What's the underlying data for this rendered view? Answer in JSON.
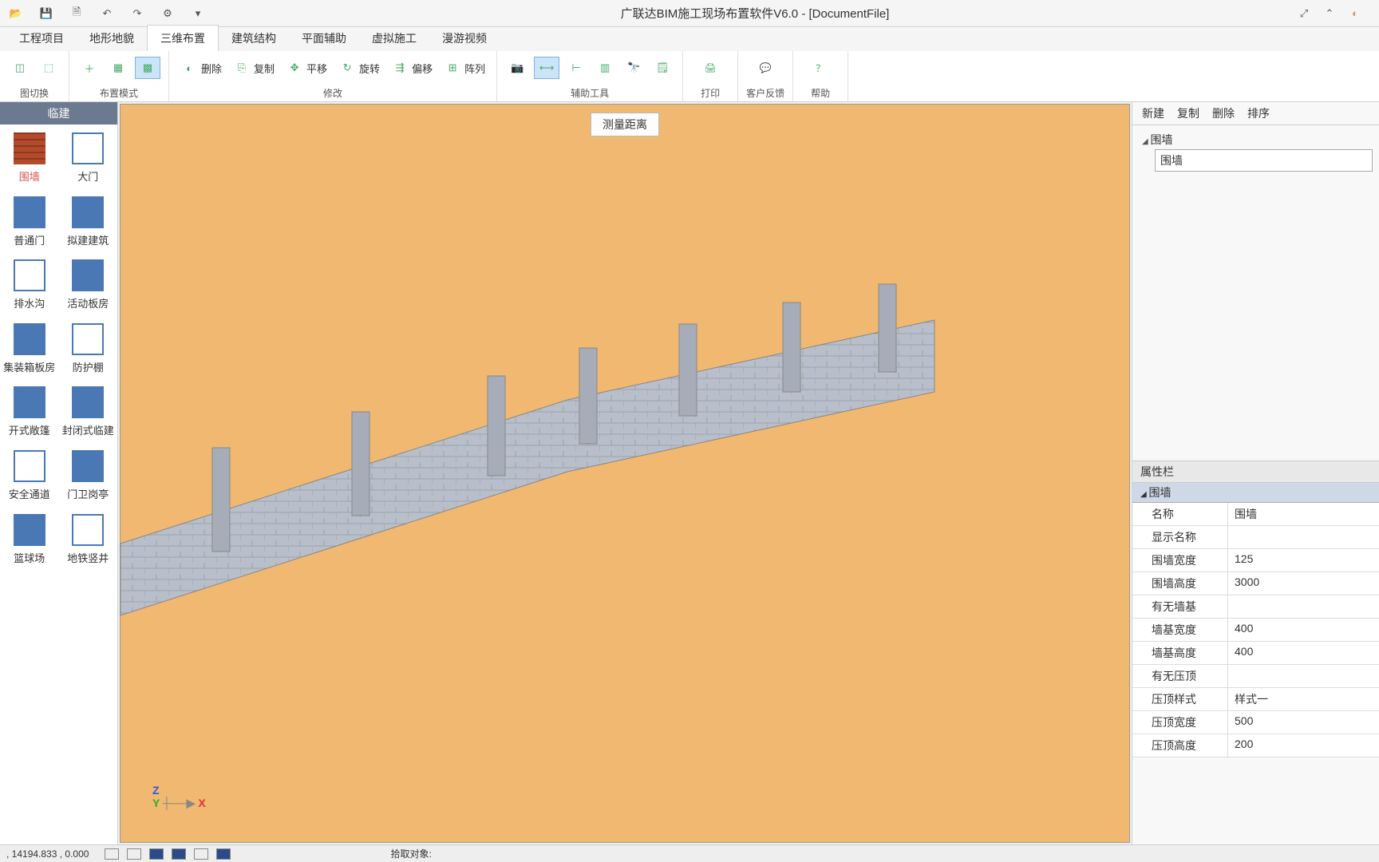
{
  "app": {
    "title": "广联达BIM施工现场布置软件V6.0 - [DocumentFile]"
  },
  "menu": {
    "tabs": [
      "工程项目",
      "地形地貌",
      "三维布置",
      "建筑结构",
      "平面辅助",
      "虚拟施工",
      "漫游视频"
    ],
    "active": 2
  },
  "ribbon": {
    "groups": [
      {
        "label": "图切换",
        "items": [
          {
            "icon": "cube",
            "big": true,
            "label": ""
          },
          {
            "icon": "cube-dash",
            "big": true,
            "label": ""
          }
        ]
      },
      {
        "label": "布置模式",
        "items": [
          {
            "icon": "plus",
            "label": ""
          },
          {
            "icon": "grid",
            "label": ""
          },
          {
            "icon": "grid-sel",
            "label": "",
            "active": true
          }
        ]
      },
      {
        "label": "修改",
        "items": [
          {
            "icon": "eraser",
            "label": "删除"
          },
          {
            "icon": "copy",
            "label": "复制"
          },
          {
            "icon": "move",
            "label": "平移"
          },
          {
            "icon": "rotate",
            "label": "旋转"
          },
          {
            "icon": "offset",
            "label": "偏移"
          },
          {
            "icon": "array",
            "label": "阵列"
          }
        ]
      },
      {
        "label": "辅助工具",
        "items": [
          {
            "icon": "camera",
            "label": ""
          },
          {
            "icon": "measure",
            "label": "",
            "active": true
          },
          {
            "icon": "ruler",
            "label": ""
          },
          {
            "icon": "chart",
            "label": ""
          },
          {
            "icon": "binoc",
            "label": ""
          },
          {
            "icon": "note",
            "label": ""
          }
        ]
      },
      {
        "label": "打印",
        "items": [
          {
            "icon": "print",
            "big": true,
            "label": ""
          }
        ]
      },
      {
        "label": "客户反馈",
        "items": [
          {
            "icon": "feedback",
            "big": true,
            "label": ""
          }
        ]
      },
      {
        "label": "帮助",
        "items": [
          {
            "icon": "help",
            "big": true,
            "label": ""
          }
        ]
      }
    ]
  },
  "palette": {
    "header": "临建",
    "items": [
      {
        "label": "围墙",
        "icon": "brick",
        "selected": true
      },
      {
        "label": "大门",
        "icon": "gate"
      },
      {
        "label": "普通门",
        "icon": "door"
      },
      {
        "label": "拟建建筑",
        "icon": "building"
      },
      {
        "label": "排水沟",
        "icon": "drain"
      },
      {
        "label": "活动板房",
        "icon": "prefab"
      },
      {
        "label": "集装箱板房",
        "icon": "container"
      },
      {
        "label": "防护棚",
        "icon": "shed"
      },
      {
        "label": "开式敞篷",
        "icon": "open"
      },
      {
        "label": "封闭式临建",
        "icon": "closed"
      },
      {
        "label": "安全通道",
        "icon": "passage"
      },
      {
        "label": "门卫岗亭",
        "icon": "guard"
      },
      {
        "label": "篮球场",
        "icon": "court"
      },
      {
        "label": "地铁竖井",
        "icon": "shaft"
      }
    ]
  },
  "viewport": {
    "float_label": "测量距离",
    "axes": {
      "x": "X",
      "y": "Y",
      "z": "Z"
    }
  },
  "rightpanel": {
    "toolbar": [
      "新建",
      "复制",
      "删除",
      "排序"
    ],
    "tree": {
      "root": "围墙",
      "selected": "围墙"
    },
    "props_header": "属性栏",
    "props_group": "围墙",
    "props": [
      {
        "k": "名称",
        "v": "围墙"
      },
      {
        "k": "显示名称",
        "v": ""
      },
      {
        "k": "围墙宽度",
        "v": "125"
      },
      {
        "k": "围墙高度",
        "v": "3000"
      },
      {
        "k": "有无墙基",
        "v": ""
      },
      {
        "k": "墙基宽度",
        "v": "400"
      },
      {
        "k": "墙基高度",
        "v": "400"
      },
      {
        "k": "有无压顶",
        "v": ""
      },
      {
        "k": "压顶样式",
        "v": "样式一"
      },
      {
        "k": "压顶宽度",
        "v": "500"
      },
      {
        "k": "压顶高度",
        "v": "200"
      }
    ]
  },
  "status": {
    "coords": ", 14194.833 ,  0.000",
    "pick": "拾取对象:"
  }
}
